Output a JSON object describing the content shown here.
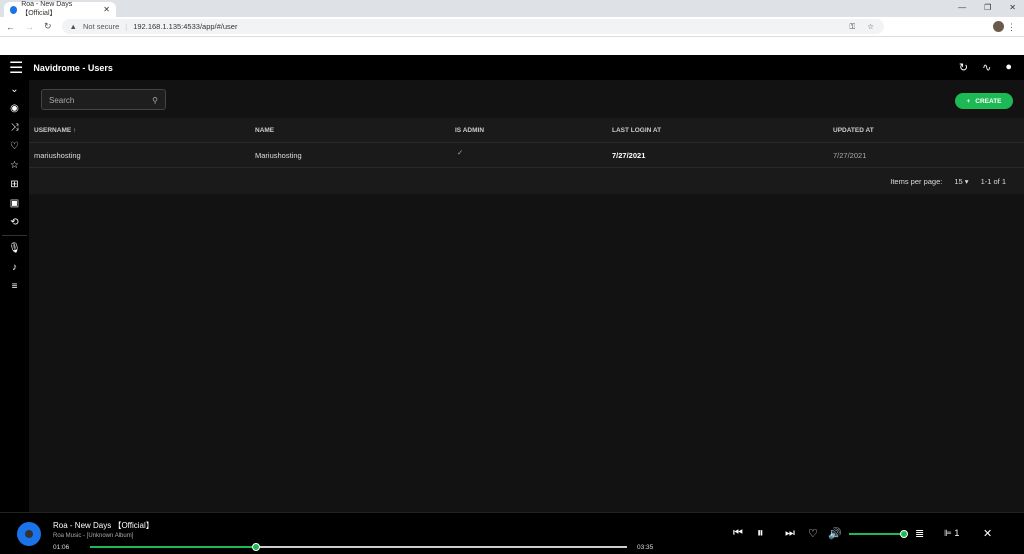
{
  "browser": {
    "tab_title": "Roa - New Days【Official】",
    "security": "Not secure",
    "url": "192.168.1.135:4533/app/#/user"
  },
  "header": {
    "title": "Navidrome - Users"
  },
  "search": {
    "placeholder": "Search"
  },
  "create_label": "CREATE",
  "table": {
    "columns": [
      "USERNAME",
      "NAME",
      "IS ADMIN",
      "LAST LOGIN AT",
      "UPDATED AT"
    ],
    "sort_indicator": "↑",
    "rows": [
      {
        "username": "mariushosting",
        "name": "Mariushosting",
        "is_admin": "✓",
        "last_login": "7/27/2021",
        "updated": "7/27/2021"
      }
    ]
  },
  "pagination": {
    "label": "Items per page:",
    "per_page": "15",
    "range": "1-1 of 1"
  },
  "player": {
    "title": "Roa - New Days 【Official】",
    "subtitle": "Roa Music - [Unknown Album]",
    "elapsed": "01:06",
    "duration": "03:35",
    "progress_percent": 31,
    "volume_percent": 100,
    "queue_count": "1"
  },
  "colors": {
    "accent": "#1db954",
    "background": "#121212"
  }
}
